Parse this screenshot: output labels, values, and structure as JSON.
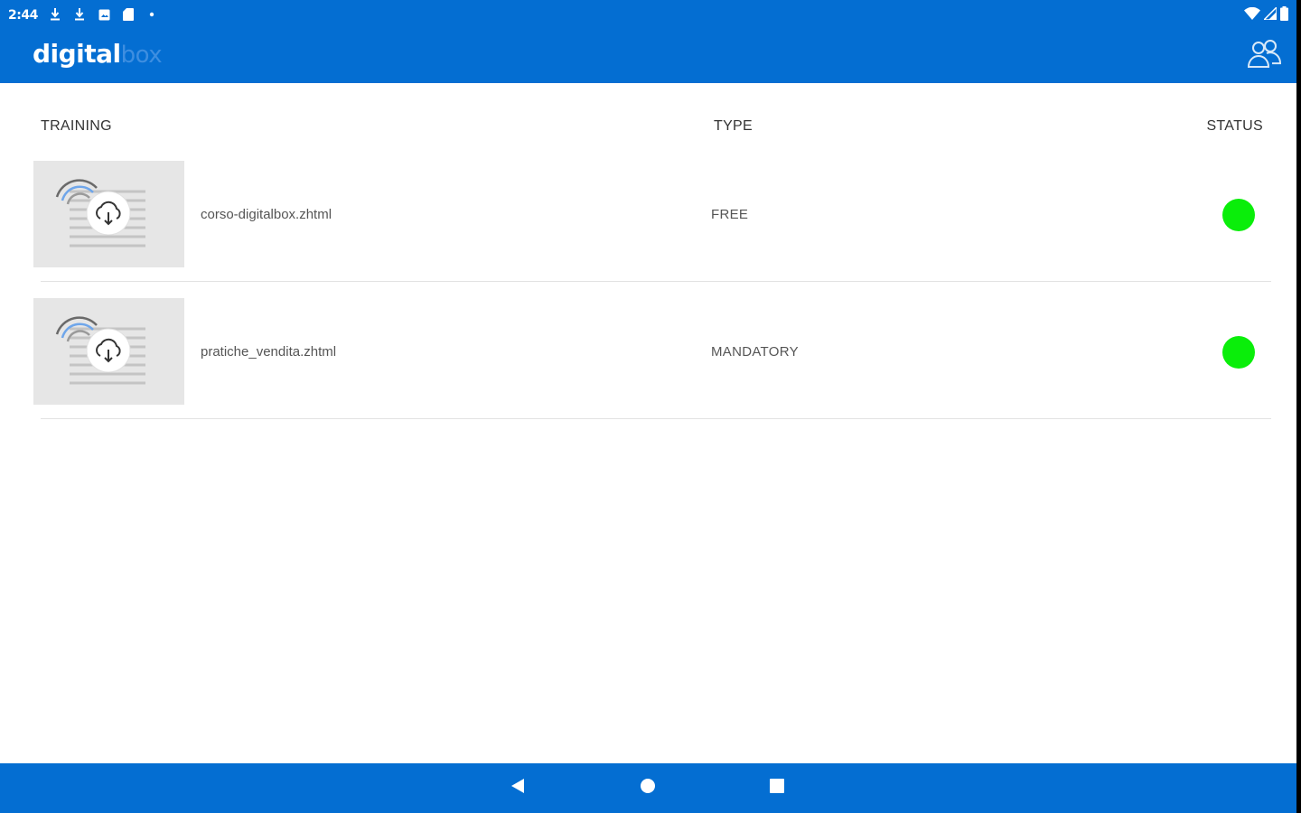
{
  "status_bar": {
    "time": "2:44",
    "left_icons": [
      "download-icon",
      "download-icon",
      "photo-icon",
      "sd-card-icon",
      "dot-icon"
    ],
    "right_icons": [
      "wifi-icon",
      "signal-icon",
      "battery-icon"
    ]
  },
  "app_bar": {
    "logo_main": "digital",
    "logo_sub": "box",
    "action_icon": "users-icon"
  },
  "table": {
    "headers": {
      "training": "TRAINING",
      "type": "TYPE",
      "status": "STATUS"
    },
    "rows": [
      {
        "thumbnail_icon": "cloud-download-icon",
        "name": "corso-digitalbox.zhtml",
        "type": "FREE",
        "status_color": "#0aee0a"
      },
      {
        "thumbnail_icon": "cloud-download-icon",
        "name": "pratiche_vendita.zhtml",
        "type": "MANDATORY",
        "status_color": "#0aee0a"
      }
    ]
  },
  "nav_bar": {
    "buttons": [
      "back-icon",
      "home-icon",
      "recents-icon"
    ]
  },
  "colors": {
    "primary": "#046ed2",
    "logo_accent": "#3e8ee0",
    "status_ok": "#0aee0a",
    "thumb_bg": "#e6e6e6"
  }
}
